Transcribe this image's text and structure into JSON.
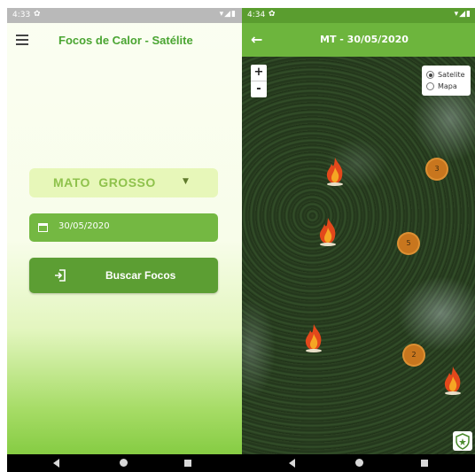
{
  "left_screen": {
    "status": {
      "time": "4:33",
      "settings_glyph": "✿",
      "icons": "▾◢▮"
    },
    "appbar": {
      "menu_icon": "hamburger-menu-icon",
      "title": "Focos de Calor - Satélite"
    },
    "state_select": {
      "value": "MATO  GROSSO",
      "caret": "▼"
    },
    "date_field": {
      "icon": "calendar-icon",
      "value": "30/05/2020"
    },
    "search_button": {
      "icon": "login-arrow-icon",
      "label": "Buscar Focos"
    }
  },
  "right_screen": {
    "status": {
      "time": "4:34",
      "settings_glyph": "✿",
      "icons": "▾◢▮"
    },
    "appbar": {
      "back_icon": "←",
      "title": "MT - 30/05/2020"
    },
    "zoom": {
      "in": "+",
      "out": "-"
    },
    "layers": [
      {
        "label": "Satelite",
        "selected": true
      },
      {
        "label": "Mapa",
        "selected": false
      }
    ],
    "clusters": [
      {
        "count": "3"
      },
      {
        "count": "5"
      },
      {
        "count": "2"
      }
    ],
    "fires": 4,
    "shield_icon": "shield-icon"
  },
  "navbar": {
    "back": "back-icon",
    "home": "home-icon",
    "recent": "recent-apps-icon"
  },
  "colors": {
    "primary": "#6db53d",
    "dark_primary": "#5c9e33",
    "title_green": "#4aa532",
    "cluster": "#c8761e"
  }
}
